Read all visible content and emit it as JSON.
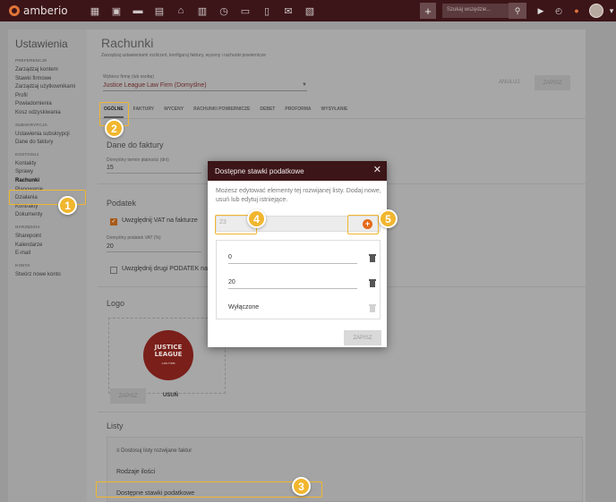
{
  "app": {
    "logo_text": "amberio"
  },
  "topbar": {
    "icons": [
      "dashboard-icon",
      "contacts-icon",
      "briefcase-icon",
      "document-icon",
      "bank-icon",
      "calendar-icon",
      "history-icon",
      "folder-icon",
      "file-icon",
      "mail-icon",
      "chart-icon"
    ],
    "search_placeholder": "Szukaj wszędzie...",
    "play_icon": "play-icon",
    "timer_icon": "timer-icon",
    "bell_icon": "bell-icon"
  },
  "sidebar": {
    "title": "Ustawienia",
    "sections": [
      {
        "head": "PREFERENCJE",
        "items": [
          "Zarządzaj kontem",
          "Stawki firmowe",
          "Zarządzaj użytkownikami",
          "Profil",
          "Powiadomienia",
          "Kosz odzyskiwania"
        ]
      },
      {
        "head": "SUBSKRYPCJA",
        "items": [
          "Ustawienia subskrypcji",
          "Dane do faktury"
        ]
      },
      {
        "head": "DOSTOSUJ",
        "items": [
          "Kontakty",
          "Sprawy",
          "Rachunki",
          "Planowanie",
          "Działania",
          "Kontrakty",
          "Dokumenty"
        ]
      },
      {
        "head": "NARZĘDZIA",
        "items": [
          "Sharepoint",
          "Kalendarze",
          "E-mail"
        ]
      },
      {
        "head": "KONTA",
        "items": [
          "Stwórz nowe konto"
        ]
      }
    ],
    "active_item": "Rachunki"
  },
  "main": {
    "title": "Rachunki",
    "subtitle": "Zarządzaj ustawieniami rozliczeń, konfiguruj faktury, wyceny i rachunki powiernicze",
    "firm_label": "Wybierz firmę (lub osobę)",
    "firm_value": "Justice League Law Firm (Domyślne)",
    "cancel_label": "ANULUJ",
    "save_label": "ZAPISZ",
    "tabs": [
      "OGÓLNE",
      "FAKTURY",
      "WYCENY",
      "RACHUNKI POWIERNICZE",
      "DEBET",
      "PROFORMA",
      "WYSYŁANIE"
    ],
    "invoice_section": {
      "title": "Dane do faktury",
      "payment_label": "Domyślny termin płatności (dni)",
      "payment_value": "15"
    },
    "tax_section": {
      "title": "Podatek",
      "vat_checkbox_label": "Uwzględnij VAT na fakturze",
      "vat_checked": true,
      "vat_rate_label": "Domyślny podatek VAT (%)",
      "vat_rate_value": "20",
      "second_tax_label": "Uwzględnij drugi PODATEK na f",
      "second_tax_checked": false
    },
    "logo_section": {
      "title": "Logo",
      "logo_line1": "JUSTICE",
      "logo_line2": "LEAGUE",
      "logo_small": "LAW FIRM",
      "save_label": "ZAPISZ",
      "remove_label": "USUŃ"
    },
    "lists_section": {
      "title": "Listy",
      "customize_link": "Dostosuj listy rozwijane faktur",
      "rows": [
        "Rodzaje ilości",
        "Dostępne stawki podatkowe"
      ]
    }
  },
  "modal": {
    "title": "Dostępne stawki podatkowe",
    "description": "Możesz edytować elementy tej rozwijanej listy. Dodaj nowe, usuń lub edytuj istniejące.",
    "new_input_value": "23",
    "items": [
      {
        "value": "0",
        "deletable": true
      },
      {
        "value": "20",
        "deletable": true
      },
      {
        "value": "Wyłączone",
        "deletable": false
      }
    ],
    "save_label": "ZAPISZ"
  },
  "annotations": {
    "badges": [
      "1",
      "2",
      "3",
      "4",
      "5"
    ],
    "color": "#f1b62e"
  }
}
